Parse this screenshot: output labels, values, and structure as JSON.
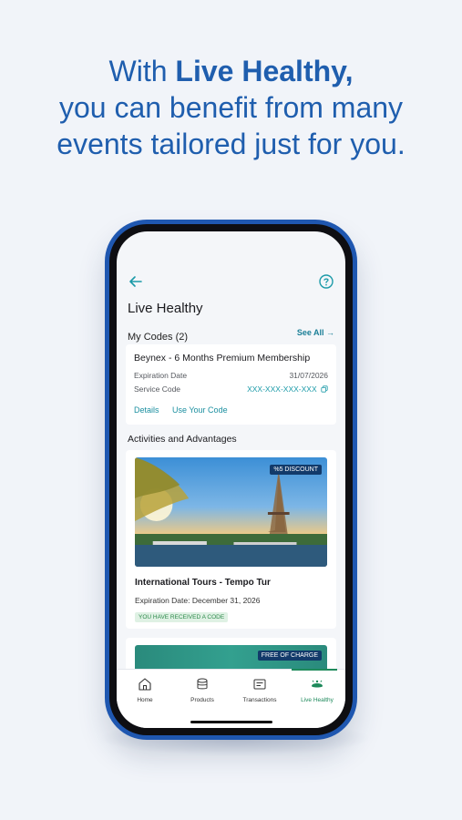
{
  "headline": {
    "line1_plain": "With ",
    "line1_bold": "Live Healthy,",
    "line2": "you can benefit from many",
    "line3": "events tailored just for you."
  },
  "screen": {
    "title": "Live Healthy",
    "my_codes": {
      "title": "My Codes (2)",
      "see_all": "See All →",
      "card": {
        "name": "Beynex - 6 Months Premium Membership",
        "expiration_label": "Expiration Date",
        "expiration_value": "31/07/2026",
        "service_label": "Service Code",
        "service_value": "XXX-XXX-XXX-XXX",
        "details_link": "Details",
        "use_code_link": "Use Your Code"
      }
    },
    "activities": {
      "title": "Activities and Advantages",
      "items": [
        {
          "badge": "%5 DISCOUNT",
          "name": "International Tours - Tempo Tur",
          "expiration": "Expiration Date: December 31, 2026",
          "status": "YOU HAVE RECEIVED A CODE"
        },
        {
          "badge": "FREE OF CHARGE"
        }
      ]
    },
    "bottom_nav": [
      {
        "label": "Home",
        "icon": "home-icon"
      },
      {
        "label": "Products",
        "icon": "products-icon"
      },
      {
        "label": "Transactions",
        "icon": "transactions-icon"
      },
      {
        "label": "Live Healthy",
        "icon": "live-healthy-icon",
        "active": true
      }
    ]
  },
  "colors": {
    "accent_blue": "#1f5eae",
    "teal_link": "#1b8fa0",
    "active_green": "#1f8a5c"
  }
}
